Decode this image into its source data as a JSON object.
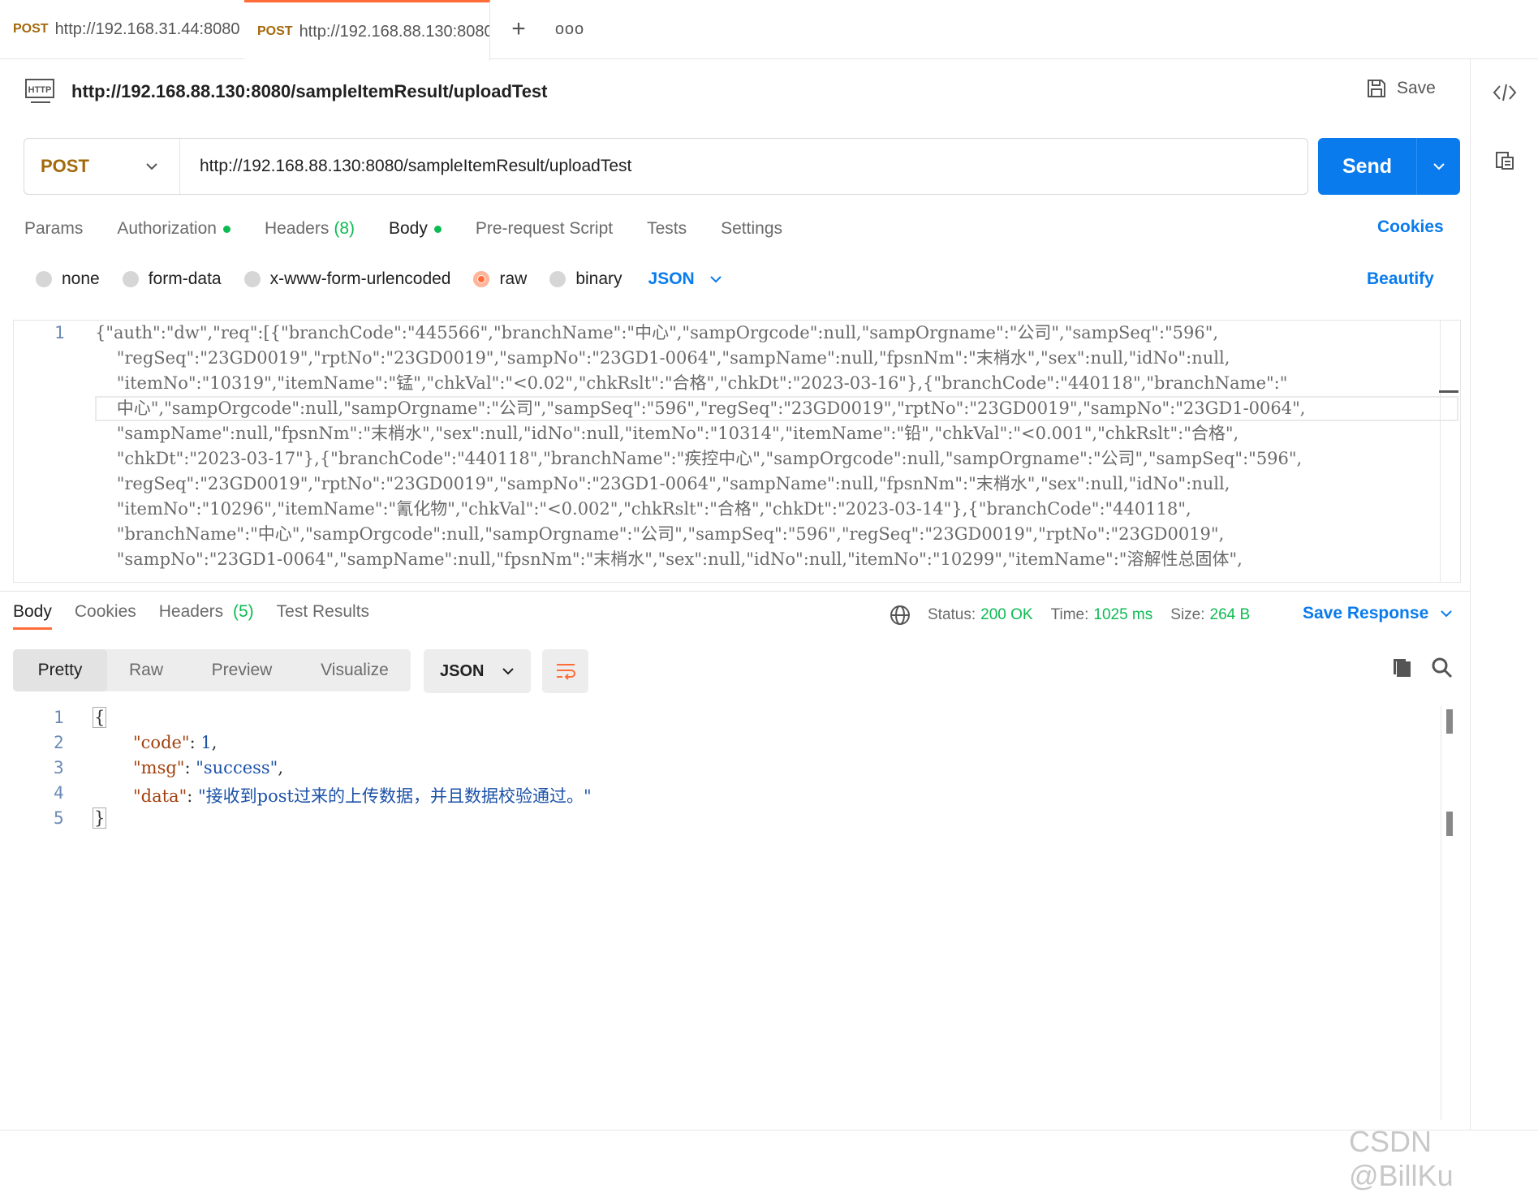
{
  "tabs": [
    {
      "method": "POST",
      "url": "http://192.168.31.44:8080"
    },
    {
      "method": "POST",
      "url": "http://192.168.88.130:8080"
    }
  ],
  "request": {
    "title": "http://192.168.88.130:8080/sampleItemResult/uploadTest",
    "save_label": "Save",
    "method": "POST",
    "url": "http://192.168.88.130:8080/sampleItemResult/uploadTest",
    "send_label": "Send"
  },
  "req_tabs": {
    "params": "Params",
    "authorization": "Authorization",
    "headers": "Headers",
    "headers_count": "(8)",
    "body": "Body",
    "prerequest": "Pre-request Script",
    "tests": "Tests",
    "settings": "Settings",
    "cookies": "Cookies"
  },
  "body_types": {
    "none": "none",
    "form_data": "form-data",
    "urlencoded": "x-www-form-urlencoded",
    "raw": "raw",
    "binary": "binary",
    "format": "JSON",
    "beautify": "Beautify",
    "selected": "raw"
  },
  "editor": {
    "line_number": "1",
    "lines": [
      "{\"auth\":\"dw\",\"req\":[{\"branchCode\":\"445566\",\"branchName\":\"中心\",\"sampOrgcode\":null,\"sampOrgname\":\"公司\",\"sampSeq\":\"596\",",
      "    \"regSeq\":\"23GD0019\",\"rptNo\":\"23GD0019\",\"sampNo\":\"23GD1-0064\",\"sampName\":null,\"fpsnNm\":\"末梢水\",\"sex\":null,\"idNo\":null,",
      "    \"itemNo\":\"10319\",\"itemName\":\"锰\",\"chkVal\":\"<0.02\",\"chkRslt\":\"合格\",\"chkDt\":\"2023-03-16\"},{\"branchCode\":\"440118\",\"branchName\":\"",
      "    中心\",\"sampOrgcode\":null,\"sampOrgname\":\"公司\",\"sampSeq\":\"596\",\"regSeq\":\"23GD0019\",\"rptNo\":\"23GD0019\",\"sampNo\":\"23GD1-0064\",",
      "    \"sampName\":null,\"fpsnNm\":\"末梢水\",\"sex\":null,\"idNo\":null,\"itemNo\":\"10314\",\"itemName\":\"铅\",\"chkVal\":\"<0.001\",\"chkRslt\":\"合格\",",
      "    \"chkDt\":\"2023-03-17\"},{\"branchCode\":\"440118\",\"branchName\":\"疾控中心\",\"sampOrgcode\":null,\"sampOrgname\":\"公司\",\"sampSeq\":\"596\",",
      "    \"regSeq\":\"23GD0019\",\"rptNo\":\"23GD0019\",\"sampNo\":\"23GD1-0064\",\"sampName\":null,\"fpsnNm\":\"末梢水\",\"sex\":null,\"idNo\":null,",
      "    \"itemNo\":\"10296\",\"itemName\":\"氰化物\",\"chkVal\":\"<0.002\",\"chkRslt\":\"合格\",\"chkDt\":\"2023-03-14\"},{\"branchCode\":\"440118\",",
      "    \"branchName\":\"中心\",\"sampOrgcode\":null,\"sampOrgname\":\"公司\",\"sampSeq\":\"596\",\"regSeq\":\"23GD0019\",\"rptNo\":\"23GD0019\",",
      "    \"sampNo\":\"23GD1-0064\",\"sampName\":null,\"fpsnNm\":\"末梢水\",\"sex\":null,\"idNo\":null,\"itemNo\":\"10299\",\"itemName\":\"溶解性总固体\","
    ]
  },
  "response": {
    "tabs": {
      "body": "Body",
      "cookies": "Cookies",
      "headers": "Headers",
      "headers_count": "(5)",
      "tests": "Test Results"
    },
    "status_label": "Status:",
    "status_value": "200 OK",
    "time_label": "Time:",
    "time_value": "1025 ms",
    "size_label": "Size:",
    "size_value": "264 B",
    "save_response": "Save Response",
    "views": {
      "pretty": "Pretty",
      "raw": "Raw",
      "preview": "Preview",
      "visualize": "Visualize"
    },
    "format": "JSON",
    "line_numbers": [
      "1",
      "2",
      "3",
      "4",
      "5"
    ],
    "json": {
      "open": "{",
      "code_key": "\"code\"",
      "code_val": "1",
      "msg_key": "\"msg\"",
      "msg_val": "\"success\"",
      "data_key": "\"data\"",
      "data_val": "\"接收到post过来的上传数据，并且数据校验通过。\"",
      "close": "}"
    }
  },
  "watermark": "CSDN @BillKu",
  "colors": {
    "accent": "#ff6c37",
    "primary": "#097bed",
    "success": "#0cbb52",
    "method": "#a3690b"
  }
}
